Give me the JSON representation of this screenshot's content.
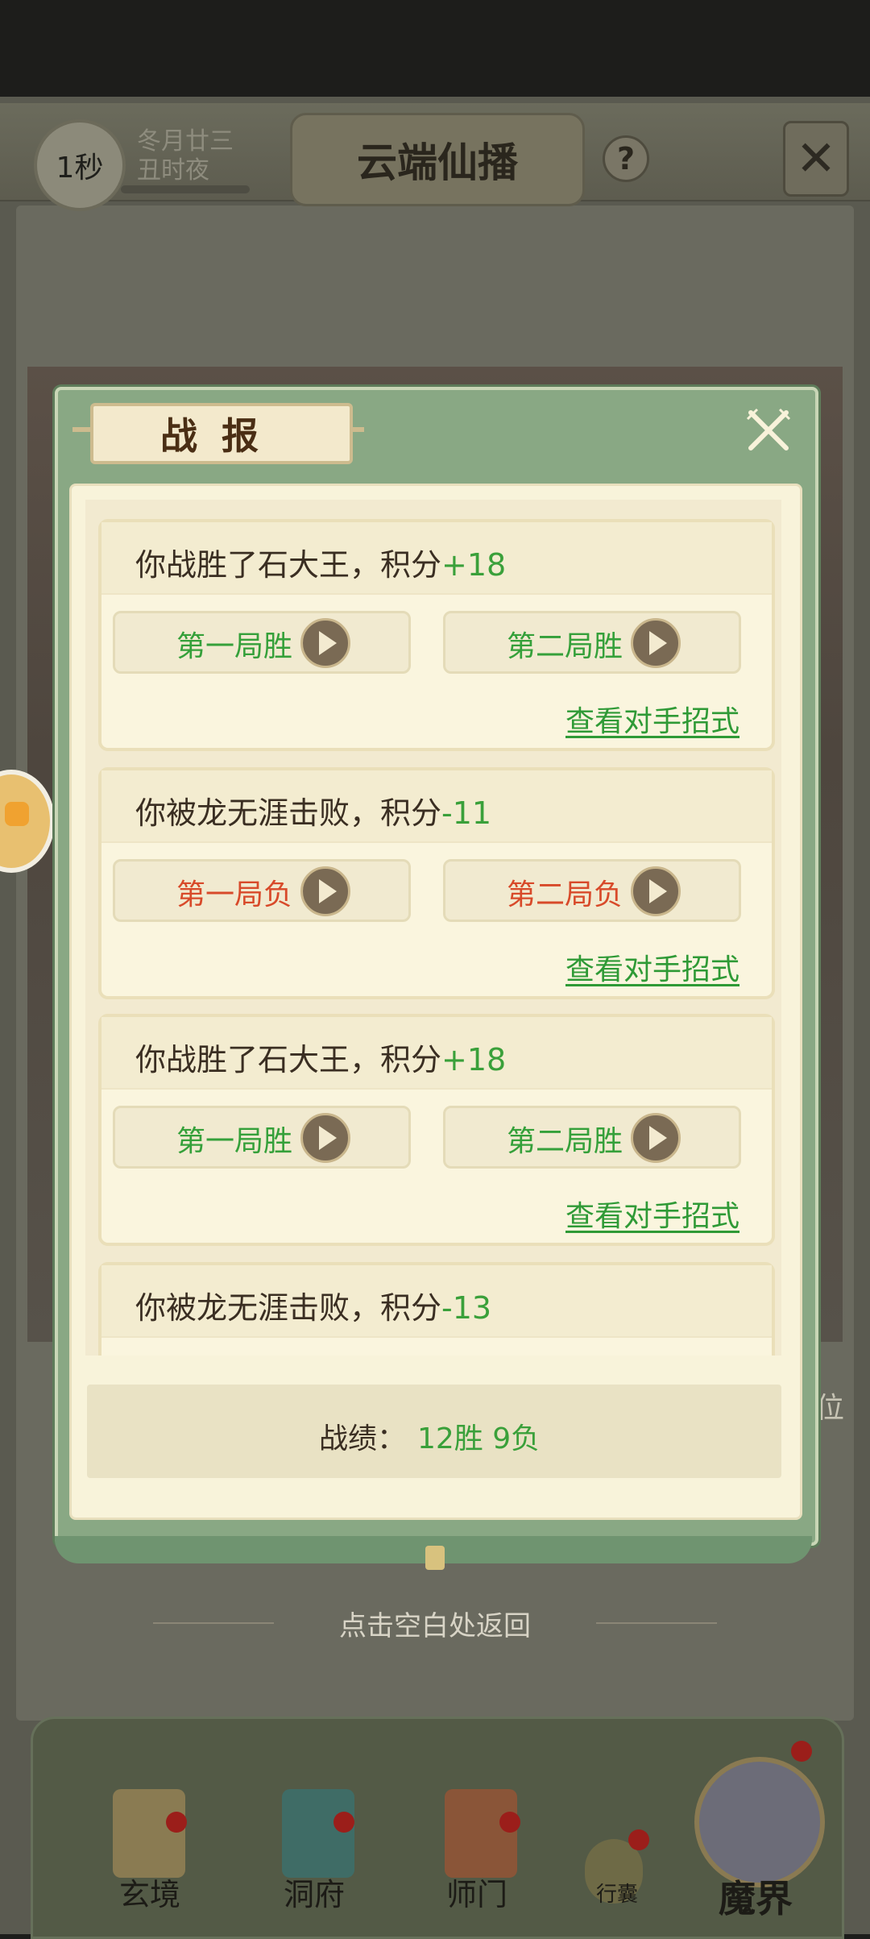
{
  "background": {
    "timer_label": "1秒",
    "date_line1": "冬月廿三",
    "date_line2": "丑时夜",
    "title": "云端仙播",
    "help_icon": "?",
    "side_text": "位"
  },
  "modal": {
    "title": "战报",
    "close_icon": "close-icon",
    "records": [
      {
        "text": "你战胜了石大王，积分",
        "delta": "+18",
        "rounds": [
          {
            "label": "第一局胜",
            "result": "win"
          },
          {
            "label": "第二局胜",
            "result": "win"
          }
        ],
        "view_label": "查看对手招式"
      },
      {
        "text": "你被龙无涯击败，积分",
        "delta": "-11",
        "rounds": [
          {
            "label": "第一局负",
            "result": "loss"
          },
          {
            "label": "第二局负",
            "result": "loss"
          }
        ],
        "view_label": "查看对手招式"
      },
      {
        "text": "你战胜了石大王，积分",
        "delta": "+18",
        "rounds": [
          {
            "label": "第一局胜",
            "result": "win"
          },
          {
            "label": "第二局胜",
            "result": "win"
          }
        ],
        "view_label": "查看对手招式"
      },
      {
        "text": "你被龙无涯击败，积分",
        "delta": "-13",
        "rounds": [],
        "view_label": ""
      }
    ],
    "summary_label": "战绩：",
    "summary_value": "12胜 9负"
  },
  "dismiss_hint": "点击空白处返回",
  "bottom_nav": {
    "items": [
      "玄境",
      "洞府",
      "师门",
      "行囊",
      "魔界"
    ]
  },
  "colors": {
    "win": "#35a03a",
    "loss": "#d84a2a",
    "modal_green": "#89a884",
    "panel_cream": "#f8f3da"
  }
}
